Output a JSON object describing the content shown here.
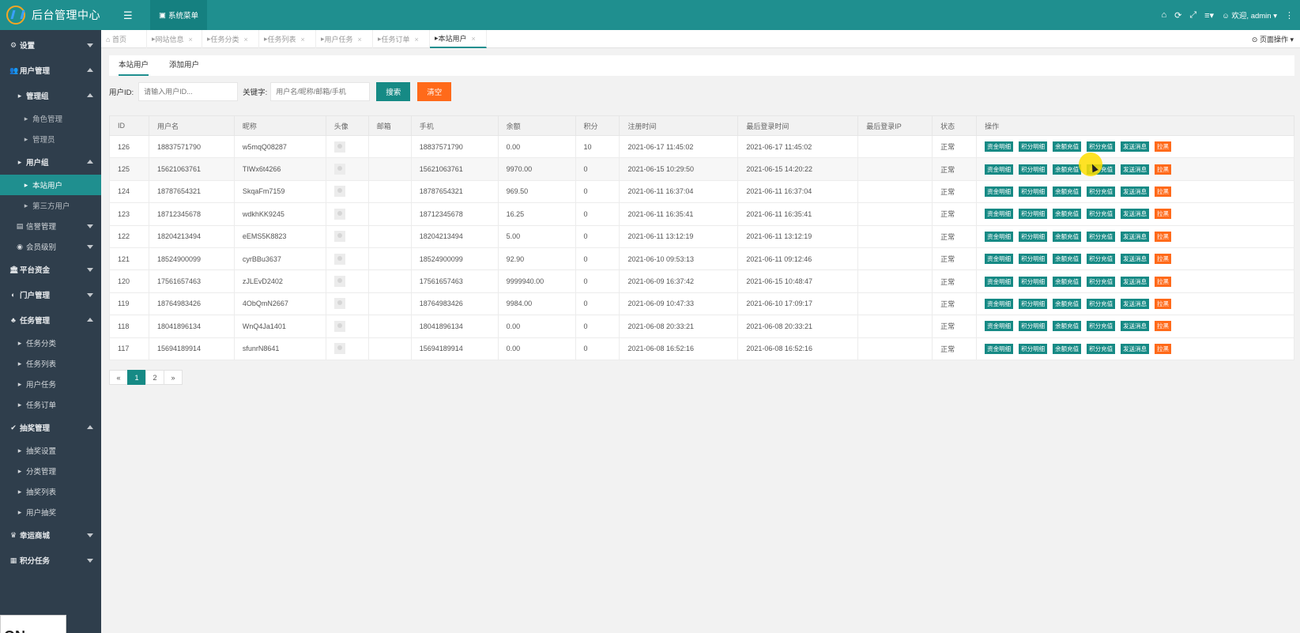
{
  "app": {
    "title": "后台管理中心"
  },
  "sidebar": {
    "settings": "设置",
    "user_mgmt": "用户管理",
    "admin_group": "管理组",
    "role_mgmt": "角色管理",
    "admin": "管理员",
    "user_group": "用户组",
    "site_users": "本站用户",
    "third_users": "第三方用户",
    "credit_mgmt": "信誉管理",
    "member_level": "会员级别",
    "platform_funds": "平台资金",
    "portal_mgmt": "门户管理",
    "task_mgmt": "任务管理",
    "task_category": "任务分类",
    "task_list": "任务列表",
    "user_tasks": "用户任务",
    "task_orders": "任务订单",
    "lottery_mgmt": "抽奖管理",
    "lottery_settings": "抽奖设置",
    "category_mgmt": "分类管理",
    "lottery_list": "抽奖列表",
    "user_lottery": "用户抽奖",
    "lucky_mall": "幸运商城",
    "points_task": "积分任务",
    "bottom_box_text": "ON"
  },
  "header": {
    "menu_label": "系统菜单",
    "welcome": "欢迎, admin"
  },
  "tabs": [
    {
      "label": "首页"
    },
    {
      "label": "网站信息"
    },
    {
      "label": "任务分类"
    },
    {
      "label": "任务列表"
    },
    {
      "label": "用户任务"
    },
    {
      "label": "任务订单"
    },
    {
      "label": "本站用户"
    }
  ],
  "page_ops": "页面操作",
  "subtabs": {
    "list": "本站用户",
    "add": "添加用户"
  },
  "search": {
    "uid_label": "用户ID:",
    "uid_placeholder": "请输入用户ID...",
    "kw_label": "关键字:",
    "kw_placeholder": "用户名/昵称/邮箱/手机",
    "search_btn": "搜索",
    "clear_btn": "清空"
  },
  "table": {
    "columns": [
      "ID",
      "用户名",
      "昵称",
      "头像",
      "邮箱",
      "手机",
      "余额",
      "积分",
      "注册时间",
      "最后登录时间",
      "最后登录IP",
      "状态",
      "操作"
    ],
    "ops": [
      "资金明细",
      "积分明细",
      "余额充值",
      "积分充值",
      "发送消息",
      "拉黑"
    ],
    "rows": [
      {
        "id": "126",
        "username": "18837571790",
        "nickname": "w5mqQ08287",
        "email": "",
        "phone": "18837571790",
        "balance": "0.00",
        "points": "10",
        "reg": "2021-06-17 11:45:02",
        "last": "2021-06-17 11:45:02",
        "ip": "",
        "status": "正常"
      },
      {
        "id": "125",
        "username": "15621063761",
        "nickname": "TIWx6t4266",
        "email": "",
        "phone": "15621063761",
        "balance": "9970.00",
        "points": "0",
        "reg": "2021-06-15 10:29:50",
        "last": "2021-06-15 14:20:22",
        "ip": "",
        "status": "正常"
      },
      {
        "id": "124",
        "username": "18787654321",
        "nickname": "SkqaFm7159",
        "email": "",
        "phone": "18787654321",
        "balance": "969.50",
        "points": "0",
        "reg": "2021-06-11 16:37:04",
        "last": "2021-06-11 16:37:04",
        "ip": "",
        "status": "正常"
      },
      {
        "id": "123",
        "username": "18712345678",
        "nickname": "wdkhKK9245",
        "email": "",
        "phone": "18712345678",
        "balance": "16.25",
        "points": "0",
        "reg": "2021-06-11 16:35:41",
        "last": "2021-06-11 16:35:41",
        "ip": "",
        "status": "正常"
      },
      {
        "id": "122",
        "username": "18204213494",
        "nickname": "eEMS5K8823",
        "email": "",
        "phone": "18204213494",
        "balance": "5.00",
        "points": "0",
        "reg": "2021-06-11 13:12:19",
        "last": "2021-06-11 13:12:19",
        "ip": "",
        "status": "正常"
      },
      {
        "id": "121",
        "username": "18524900099",
        "nickname": "cyrBBu3637",
        "email": "",
        "phone": "18524900099",
        "balance": "92.90",
        "points": "0",
        "reg": "2021-06-10 09:53:13",
        "last": "2021-06-11 09:12:46",
        "ip": "",
        "status": "正常"
      },
      {
        "id": "120",
        "username": "17561657463",
        "nickname": "zJLEvD2402",
        "email": "",
        "phone": "17561657463",
        "balance": "9999940.00",
        "points": "0",
        "reg": "2021-06-09 16:37:42",
        "last": "2021-06-15 10:48:47",
        "ip": "",
        "status": "正常"
      },
      {
        "id": "119",
        "username": "18764983426",
        "nickname": "4ObQmN2667",
        "email": "",
        "phone": "18764983426",
        "balance": "9984.00",
        "points": "0",
        "reg": "2021-06-09 10:47:33",
        "last": "2021-06-10 17:09:17",
        "ip": "",
        "status": "正常"
      },
      {
        "id": "118",
        "username": "18041896134",
        "nickname": "WnQ4Ja1401",
        "email": "",
        "phone": "18041896134",
        "balance": "0.00",
        "points": "0",
        "reg": "2021-06-08 20:33:21",
        "last": "2021-06-08 20:33:21",
        "ip": "",
        "status": "正常"
      },
      {
        "id": "117",
        "username": "15694189914",
        "nickname": "sfunrN8641",
        "email": "",
        "phone": "15694189914",
        "balance": "0.00",
        "points": "0",
        "reg": "2021-06-08 16:52:16",
        "last": "2021-06-08 16:52:16",
        "ip": "",
        "status": "正常"
      }
    ]
  },
  "pager": {
    "prev": "«",
    "pages": [
      "1",
      "2"
    ],
    "next": "»",
    "current": "1"
  },
  "colors": {
    "teal": "#1f8f8f",
    "sidebar": "#2f3e4c",
    "danger": "#ff6a1a"
  }
}
